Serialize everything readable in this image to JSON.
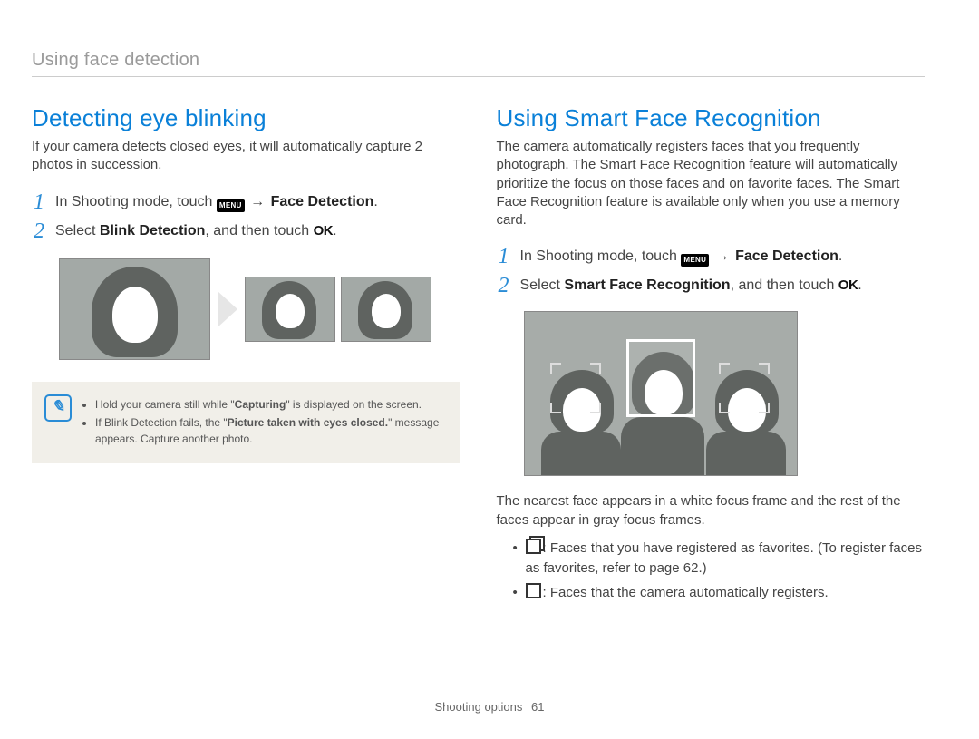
{
  "breadcrumb": "Using face detection",
  "left": {
    "heading": "Detecting eye blinking",
    "intro": "If your camera detects closed eyes, it will automatically capture 2 photos in succession.",
    "step1_pre": "In Shooting mode, touch ",
    "step1_menu": "MENU",
    "step1_arrow": " → ",
    "step1_bold": "Face Detection",
    "step1_post": ".",
    "step2_pre": "Select ",
    "step2_bold": "Blink Detection",
    "step2_mid": ", and then touch ",
    "step2_ok": "OK",
    "step2_post": ".",
    "note1_pre": "Hold your camera still while \"",
    "note1_bold": "Capturing",
    "note1_post": "\" is displayed on the screen.",
    "note2_pre": "If Blink Detection fails, the \"",
    "note2_bold": "Picture taken with eyes closed.",
    "note2_post": "\" message appears. Capture another photo."
  },
  "right": {
    "heading": "Using Smart Face Recognition",
    "intro": "The camera automatically registers faces that you frequently photograph. The Smart Face Recognition feature will automatically prioritize the focus on those faces and on favorite faces. The Smart Face Recognition feature is available only when you use a memory card.",
    "step1_pre": "In Shooting mode, touch ",
    "step1_menu": "MENU",
    "step1_arrow": " → ",
    "step1_bold": "Face Detection",
    "step1_post": ".",
    "step2_pre": "Select ",
    "step2_bold": "Smart Face Recognition",
    "step2_mid": ", and then touch ",
    "step2_ok": "OK",
    "step2_post": ".",
    "after_img": "The nearest face appears in a white focus frame and the rest of the faces appear in gray focus frames.",
    "bullet1": ": Faces that you have registered as favorites. (To register faces as favorites, refer to page 62.)",
    "bullet2": ": Faces that the camera automatically registers."
  },
  "footer": {
    "label": "Shooting options",
    "page": "61"
  }
}
